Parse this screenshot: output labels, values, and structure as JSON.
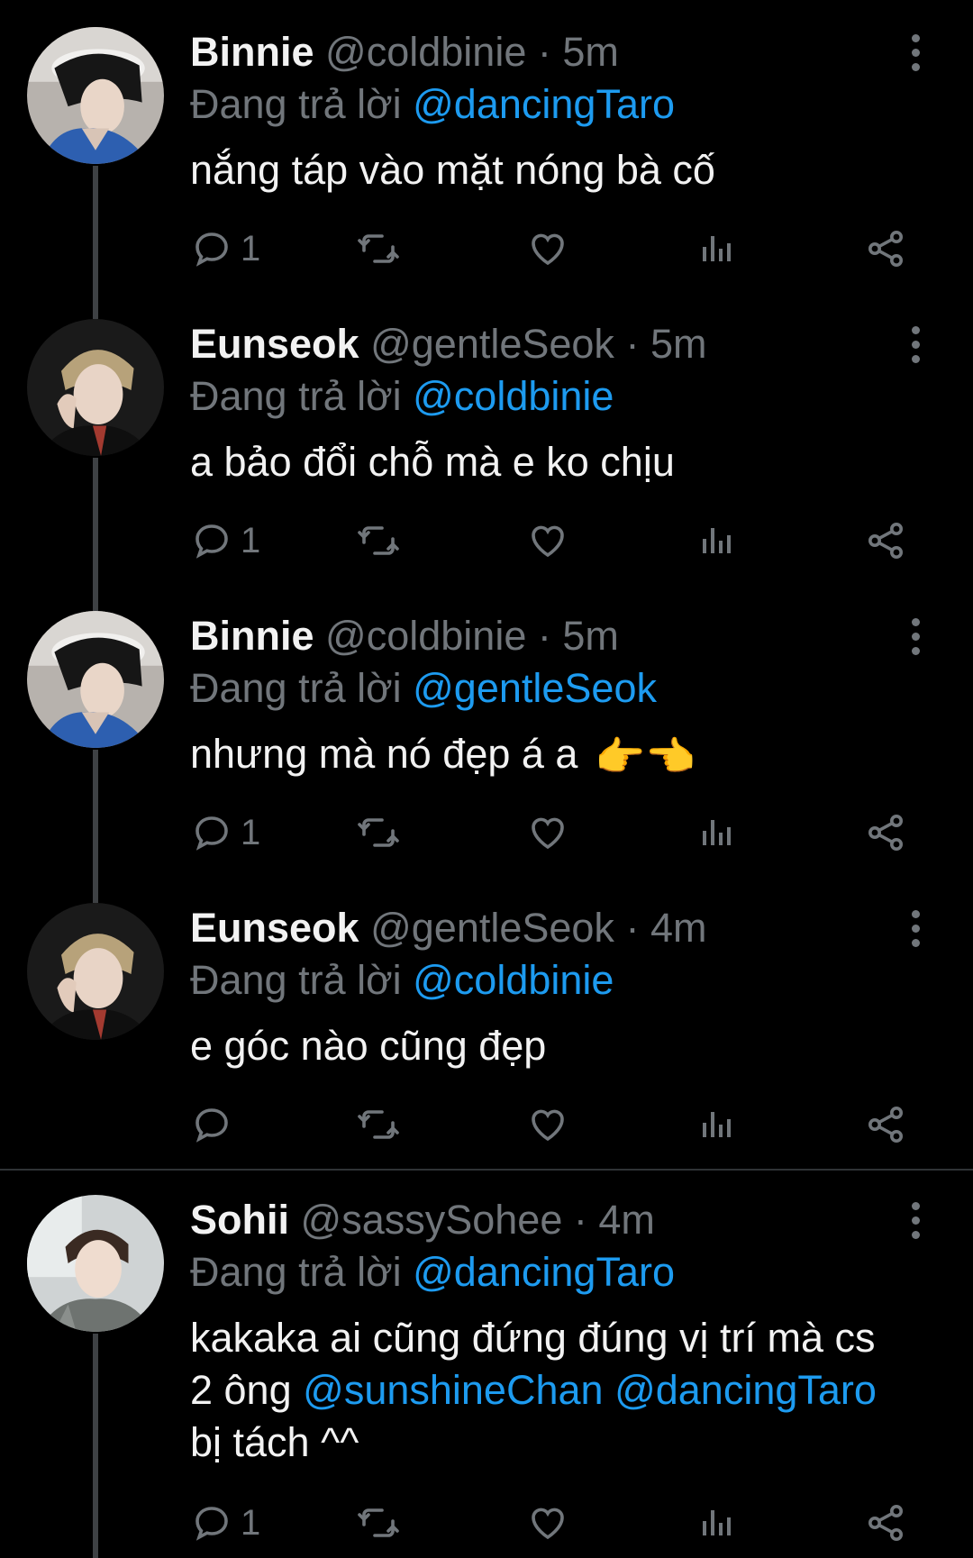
{
  "tweets": [
    {
      "name": "Binnie",
      "handle": "@coldbinie",
      "dot": "·",
      "time": "5m",
      "reply_prefix": "Đang trả lời",
      "reply_to": "@dancingTaro",
      "text": "nắng táp vào mặt nóng bà cố",
      "reply_count": "1",
      "avatar": "binnie"
    },
    {
      "name": "Eunseok",
      "handle": "@gentleSeok",
      "dot": "·",
      "time": "5m",
      "reply_prefix": "Đang trả lời",
      "reply_to": "@coldbinie",
      "text": "a bảo đổi chỗ mà e ko chịu",
      "reply_count": "1",
      "avatar": "eunseok"
    },
    {
      "name": "Binnie",
      "handle": "@coldbinie",
      "dot": "·",
      "time": "5m",
      "reply_prefix": "Đang trả lời",
      "reply_to": "@gentleSeok",
      "text": "nhưng mà nó đẹp á a",
      "emoji": "👉👈",
      "reply_count": "1",
      "avatar": "binnie"
    },
    {
      "name": "Eunseok",
      "handle": "@gentleSeok",
      "dot": "·",
      "time": "4m",
      "reply_prefix": "Đang trả lời",
      "reply_to": "@coldbinie",
      "text": "e góc nào cũng đẹp",
      "reply_count": "",
      "avatar": "eunseok"
    },
    {
      "name": "Sohii",
      "handle": "@sassySohee",
      "dot": "·",
      "time": "4m",
      "reply_prefix": "Đang trả lời",
      "reply_to": "@dancingTaro",
      "text_part1": "kakaka ai cũng đứng đúng vị trí mà cs",
      "text_part2": "2 ông",
      "mention1": "@sunshineChan",
      "mention2": "@dancingTaro",
      "text_part3": "bị tách ^^",
      "reply_count": "1",
      "avatar": "sohii"
    }
  ],
  "icons": {
    "reply": "reply-icon",
    "retweet": "retweet-icon",
    "like": "heart-icon",
    "views": "analytics-icon",
    "share": "share-icon",
    "more": "more-icon"
  },
  "colors": {
    "accent": "#1d9bf0",
    "muted": "#71767b",
    "background": "#000000"
  }
}
